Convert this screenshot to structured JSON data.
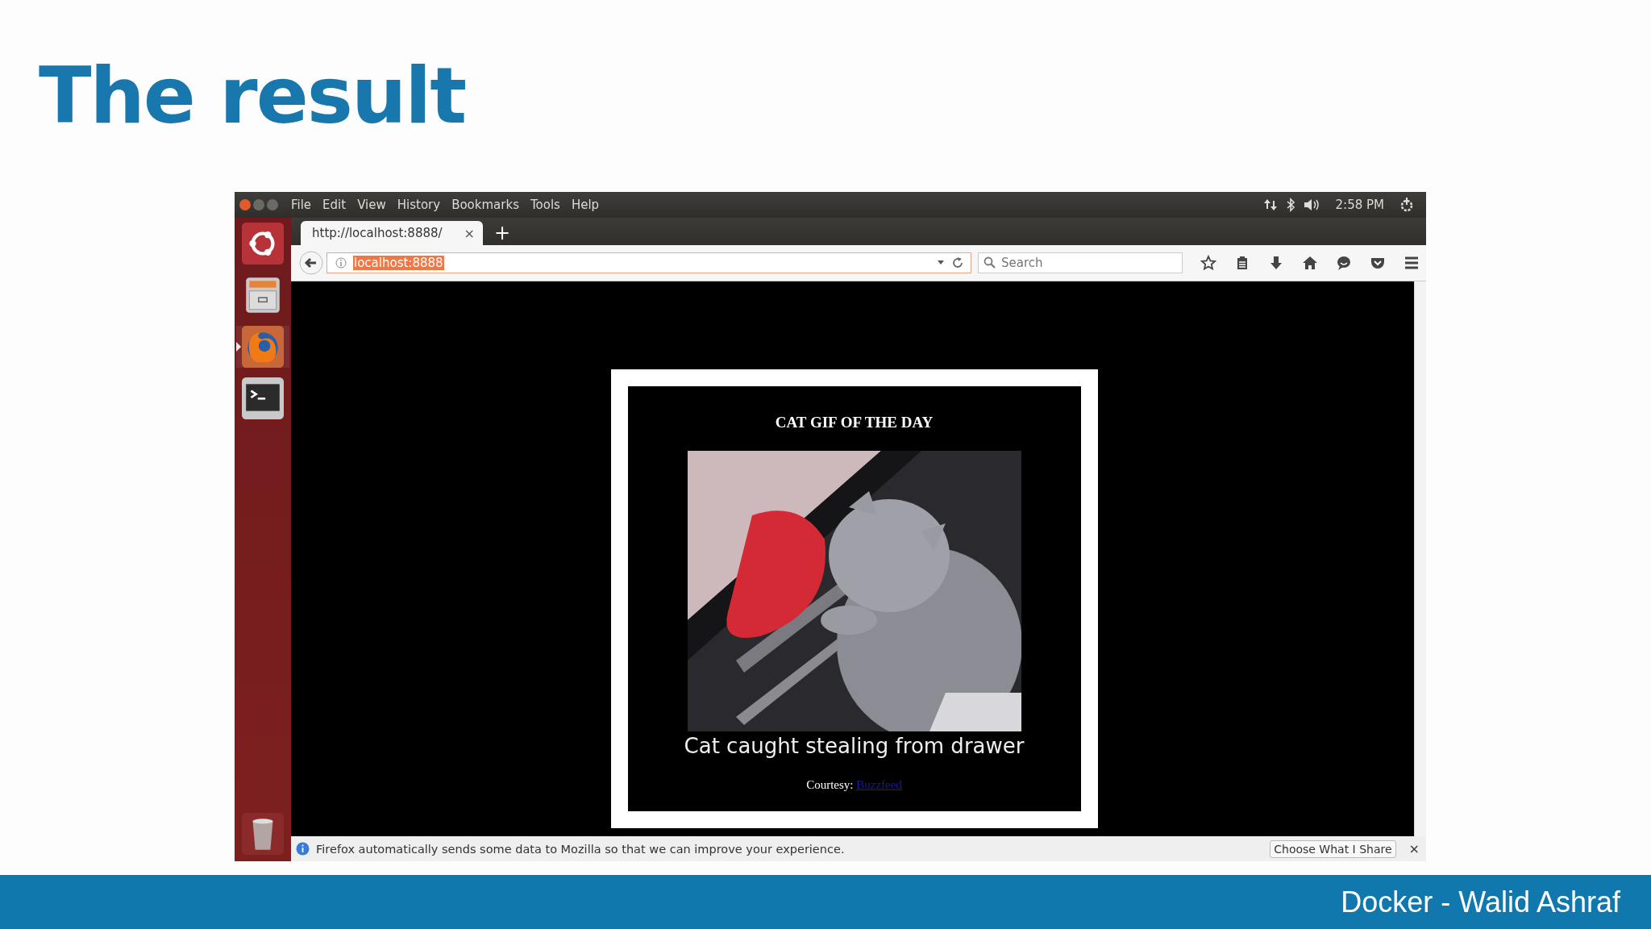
{
  "slide_title": "The result",
  "desktop": {
    "menus": [
      "File",
      "Edit",
      "View",
      "History",
      "Bookmarks",
      "Tools",
      "Help"
    ],
    "clock": "2:58 PM",
    "launcher": [
      {
        "kind": "ubuntu",
        "selected": false
      },
      {
        "kind": "files",
        "selected": false
      },
      {
        "kind": "firefox",
        "selected": true
      },
      {
        "kind": "terminal",
        "selected": false
      },
      {
        "kind": "trash",
        "selected": false
      }
    ]
  },
  "browser": {
    "tab": {
      "title": "http://localhost:8888/",
      "close": "×"
    },
    "new_tab": "+",
    "url": {
      "value": "localhost:8888",
      "highlighted": true
    },
    "search": {
      "placeholder": "Search"
    },
    "page": {
      "heading": "CAT GIF OF THE DAY",
      "caption": "Cat caught stealing from drawer",
      "courtesy": "Courtesy:",
      "link": "Buzzfeed"
    },
    "notification": {
      "text": "Firefox automatically sends some data to Mozilla so that we can improve your experience.",
      "button": "Choose What I Share",
      "close": "×"
    }
  },
  "footer": "Docker - Walid Ashraf"
}
